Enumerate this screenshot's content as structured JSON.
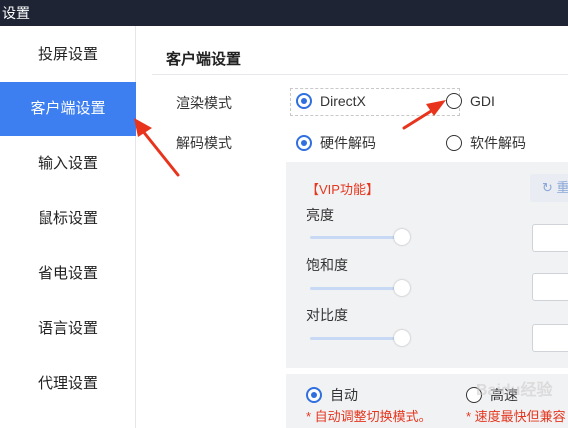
{
  "window": {
    "title": "设置"
  },
  "sidebar": {
    "items": [
      {
        "label": "投屏设置",
        "active": false
      },
      {
        "label": "客户端设置",
        "active": true
      },
      {
        "label": "输入设置",
        "active": false
      },
      {
        "label": "鼠标设置",
        "active": false
      },
      {
        "label": "省电设置",
        "active": false
      },
      {
        "label": "语言设置",
        "active": false
      },
      {
        "label": "代理设置",
        "active": false
      }
    ]
  },
  "main": {
    "section_title": "客户端设置",
    "render": {
      "label": "渲染模式",
      "options": [
        {
          "label": "DirectX",
          "checked": true
        },
        {
          "label": "GDI",
          "checked": false
        }
      ]
    },
    "decode": {
      "label": "解码模式",
      "options": [
        {
          "label": "硬件解码",
          "checked": true
        },
        {
          "label": "软件解码",
          "checked": false
        }
      ]
    },
    "vip": {
      "tag": "【VIP功能】",
      "reset_label": "重",
      "sliders": [
        {
          "label": "亮度"
        },
        {
          "label": "饱和度"
        },
        {
          "label": "对比度"
        }
      ]
    },
    "speed": {
      "options": [
        {
          "label": "自动",
          "checked": true
        },
        {
          "label": "高速",
          "checked": false
        }
      ],
      "hints": [
        "* 自动调整切换模式。",
        "* 速度最快但兼容"
      ]
    }
  },
  "watermark": "Baidu经验",
  "colors": {
    "accent": "#3d7ff0",
    "titlebar": "#1e2434",
    "annotation_arrow": "#e8341c",
    "vip_text": "#e5371f"
  }
}
